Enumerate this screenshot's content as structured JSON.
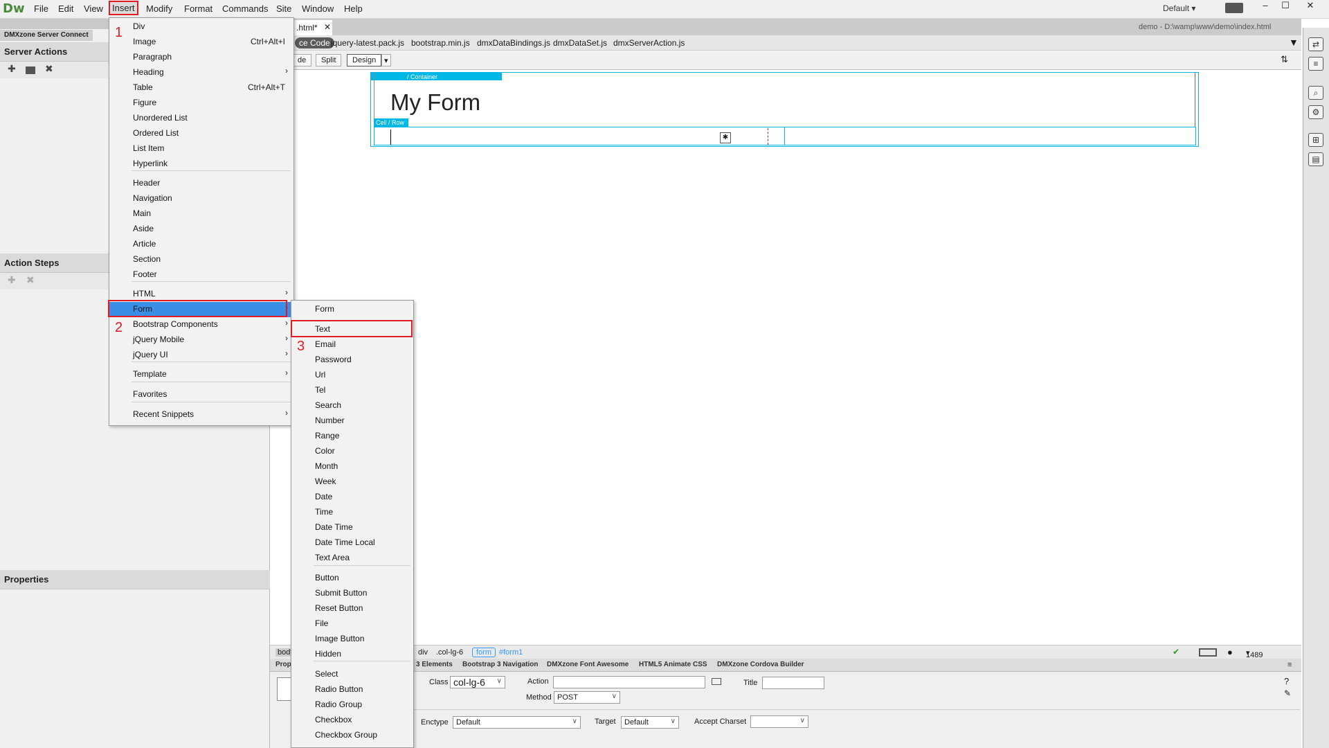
{
  "app": {
    "logo": "Dw",
    "workspace": "Default"
  },
  "menubar": [
    "File",
    "Edit",
    "View",
    "Insert",
    "Modify",
    "Format",
    "Commands",
    "Site",
    "Window",
    "Help"
  ],
  "window_controls": [
    "–",
    "☐",
    "✕"
  ],
  "left": {
    "panel_tab": "DMXzone Server Connect",
    "server_actions": "Server Actions",
    "action_steps": "Action Steps",
    "properties": "Properties"
  },
  "doc": {
    "tab": ".html*",
    "path": "demo - D:\\wamp\\www\\demo\\index.html",
    "related": [
      "ce Code",
      "jquery-latest.pack.js",
      "bootstrap.min.js",
      "dmxDataBindings.js",
      "dmxDataSet.js",
      "dmxServerAction.js"
    ],
    "views": [
      "de",
      "Split",
      "Design"
    ]
  },
  "canvas": {
    "container_label": "/ Container",
    "heading": "My Form",
    "cell_label": "Cell / Row"
  },
  "status": {
    "tags": [
      "body",
      "div",
      ".col-lg-6",
      "form",
      "#form1"
    ],
    "size": "1489 x 829"
  },
  "prop_tabs": [
    "Prop",
    "3 Elements",
    "Bootstrap 3 Navigation",
    "DMXzone Font Awesome",
    "HTML5 Animate CSS",
    "DMXzone Cordova Builder"
  ],
  "props": {
    "class_label": "Class",
    "class_value": "col-lg-6",
    "action_label": "Action",
    "title_label": "Title",
    "method_label": "Method",
    "method_value": "POST",
    "enctype_label": "Enctype",
    "enctype_value": "Default",
    "target_label": "Target",
    "target_value": "Default",
    "charset_label": "Accept Charset"
  },
  "insert_menu": [
    {
      "label": "Div"
    },
    {
      "label": "Image",
      "shortcut": "Ctrl+Alt+I"
    },
    {
      "label": "Paragraph"
    },
    {
      "label": "Heading",
      "sub": true
    },
    {
      "label": "Table",
      "shortcut": "Ctrl+Alt+T"
    },
    {
      "label": "Figure"
    },
    {
      "label": "Unordered List"
    },
    {
      "label": "Ordered List"
    },
    {
      "label": "List Item"
    },
    {
      "label": "Hyperlink"
    },
    {
      "label": "Header"
    },
    {
      "label": "Navigation"
    },
    {
      "label": "Main"
    },
    {
      "label": "Aside"
    },
    {
      "label": "Article"
    },
    {
      "label": "Section"
    },
    {
      "label": "Footer"
    },
    {
      "label": "HTML",
      "sub": true
    },
    {
      "label": "Form",
      "sub": true
    },
    {
      "label": "Bootstrap Components",
      "sub": true
    },
    {
      "label": "jQuery Mobile",
      "sub": true
    },
    {
      "label": "jQuery UI",
      "sub": true
    },
    {
      "label": "Template",
      "sub": true
    },
    {
      "label": "Favorites"
    },
    {
      "label": "Recent Snippets",
      "sub": true
    }
  ],
  "form_menu": [
    "Form",
    "Text",
    "Email",
    "Password",
    "Url",
    "Tel",
    "Search",
    "Number",
    "Range",
    "Color",
    "Month",
    "Week",
    "Date",
    "Time",
    "Date Time",
    "Date Time Local",
    "Text Area",
    "Button",
    "Submit Button",
    "Reset Button",
    "File",
    "Image Button",
    "Hidden",
    "Select",
    "Radio Button",
    "Radio Group",
    "Checkbox",
    "Checkbox Group"
  ],
  "steps": [
    "1",
    "2",
    "3"
  ],
  "colors": {
    "highlight": "#e01b24",
    "selection": "#3399ff",
    "guide": "#00b7e6"
  }
}
